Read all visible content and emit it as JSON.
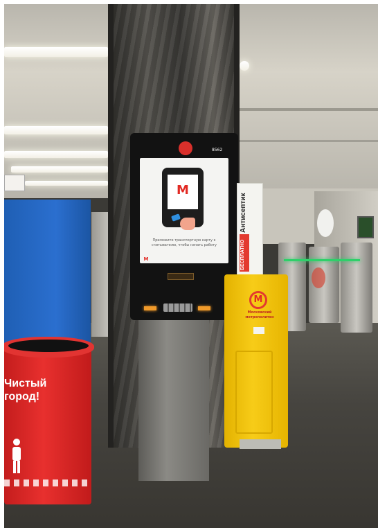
{
  "scene": {
    "kiosk_screen_text": "Приложите транспортную карту к считывателю, чтобы начать работу",
    "kiosk_number": "8562",
    "metro_logo_letter": "M",
    "antiseptic_label": "Антисептик",
    "free_label": "БЕСПЛАТНО",
    "metro_name": "Московский метрополитен",
    "bin_slogan": "Чистый город!",
    "colors": {
      "metro_red": "#e22a24",
      "sanitizer_yellow": "#f7cc18",
      "bin_red": "#e8302e",
      "wall_blue": "#2b6fcf"
    }
  }
}
